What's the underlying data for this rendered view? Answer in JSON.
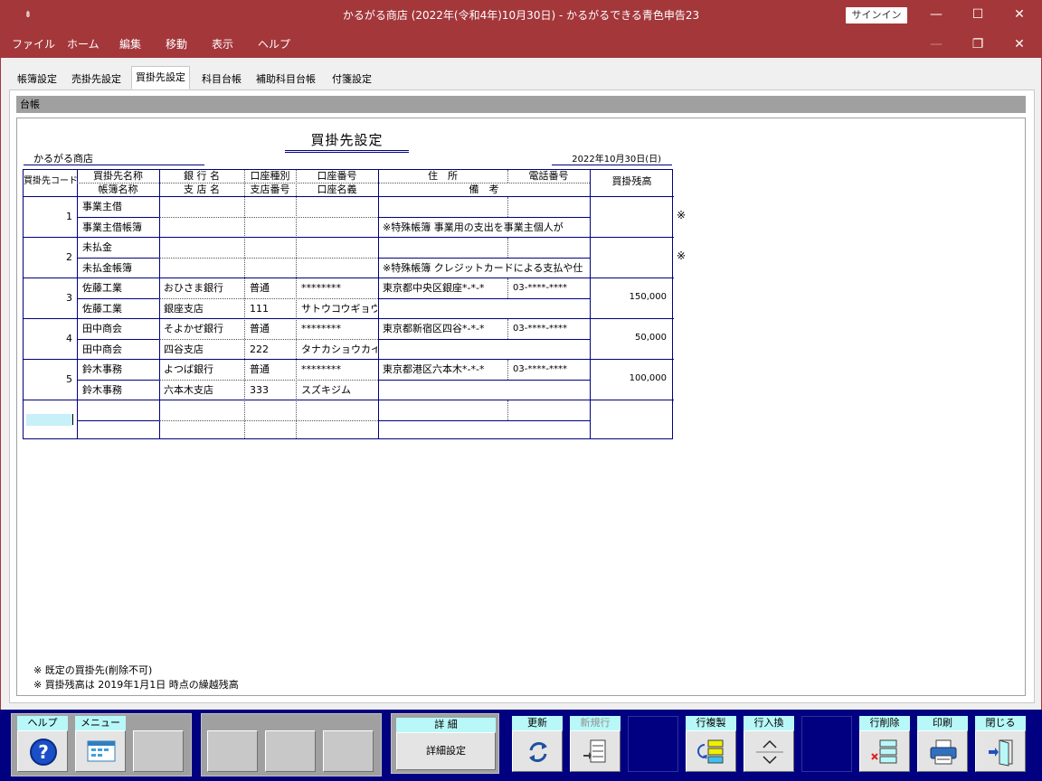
{
  "window": {
    "title": "かるがる商店 (2022年(令和4年)10月30日)  -  かるがるできる青色申告23",
    "signin_label": "サインイン",
    "minimize": "—",
    "maximize": "☐",
    "close": "✕",
    "restore": "❐"
  },
  "menu": [
    "ファイル",
    "ホーム",
    "編集",
    "移動",
    "表示",
    "ヘルプ"
  ],
  "tabs": [
    "帳簿設定",
    "売掛先設定",
    "買掛先設定",
    "科目台帳",
    "補助科目台帳",
    "付箋設定"
  ],
  "active_tab": "買掛先設定",
  "panel_title": "台帳",
  "report": {
    "title": "買掛先設定",
    "company": "かるがる商店",
    "date": "2022年10月30日(日)"
  },
  "columns": {
    "code": "買掛先コード",
    "name": "買掛先名称",
    "book": "帳簿名称",
    "bank": "銀 行 名",
    "branch": "支 店 名",
    "acct_type": "口座種別",
    "branch_no": "支店番号",
    "acct_no": "口座番号",
    "acct_holder": "口座名義",
    "address": "住　所",
    "memo": "備　考",
    "phone": "電話番号",
    "balance": "買掛残高"
  },
  "rows": [
    {
      "code": "1",
      "name": "事業主借",
      "book": "事業主借帳簿",
      "bank": "",
      "branch": "",
      "acct_type": "",
      "branch_no": "",
      "acct_no": "",
      "acct_holder": "",
      "address": "",
      "phone": "",
      "memo": "※特殊帳簿 事業用の支出を事業主個人が",
      "balance": "",
      "mark": "※"
    },
    {
      "code": "2",
      "name": "未払金",
      "book": "未払金帳簿",
      "bank": "",
      "branch": "",
      "acct_type": "",
      "branch_no": "",
      "acct_no": "",
      "acct_holder": "",
      "address": "",
      "phone": "",
      "memo": "※特殊帳簿 クレジットカードによる支払や仕",
      "balance": "",
      "mark": "※"
    },
    {
      "code": "3",
      "name": "佐藤工業",
      "book": "佐藤工業",
      "bank": "おひさま銀行",
      "branch": "銀座支店",
      "acct_type": "普通",
      "branch_no": "111",
      "acct_no": "********",
      "acct_holder": "サトウコウギョウ",
      "address": "東京都中央区銀座*-*-*",
      "phone": "03-****-****",
      "memo": "",
      "balance": "150,000",
      "mark": ""
    },
    {
      "code": "4",
      "name": "田中商会",
      "book": "田中商会",
      "bank": "そよかぜ銀行",
      "branch": "四谷支店",
      "acct_type": "普通",
      "branch_no": "222",
      "acct_no": "********",
      "acct_holder": "タナカショウカイ",
      "address": "東京都新宿区四谷*-*-*",
      "phone": "03-****-****",
      "memo": "",
      "balance": "50,000",
      "mark": ""
    },
    {
      "code": "5",
      "name": "鈴木事務",
      "book": "鈴木事務",
      "bank": "よつば銀行",
      "branch": "六本木支店",
      "acct_type": "普通",
      "branch_no": "333",
      "acct_no": "********",
      "acct_holder": "スズキジム",
      "address": "東京都港区六本木*-*-*",
      "phone": "03-****-****",
      "memo": "",
      "balance": "100,000",
      "mark": ""
    }
  ],
  "notes": [
    "※ 既定の買掛先(削除不可)",
    "※ 買掛残高は 2019年1月1日 時点の繰越残高"
  ],
  "toolbar": {
    "help": "ヘルプ",
    "menu": "メニュー",
    "detail_header": "詳 細",
    "detail_button": "詳細設定",
    "refresh": "更新",
    "new_row": "新規行",
    "copy_row": "行複製",
    "swap_rows": "行入換",
    "delete_row": "行削除",
    "print": "印刷",
    "close": "閉じる"
  },
  "colors": {
    "titlebar": "#a4373a",
    "toolbar": "#000080",
    "grid_line": "#000080",
    "label_bg": "#b8f8f8",
    "input_highlight": "#c8f0f8"
  }
}
